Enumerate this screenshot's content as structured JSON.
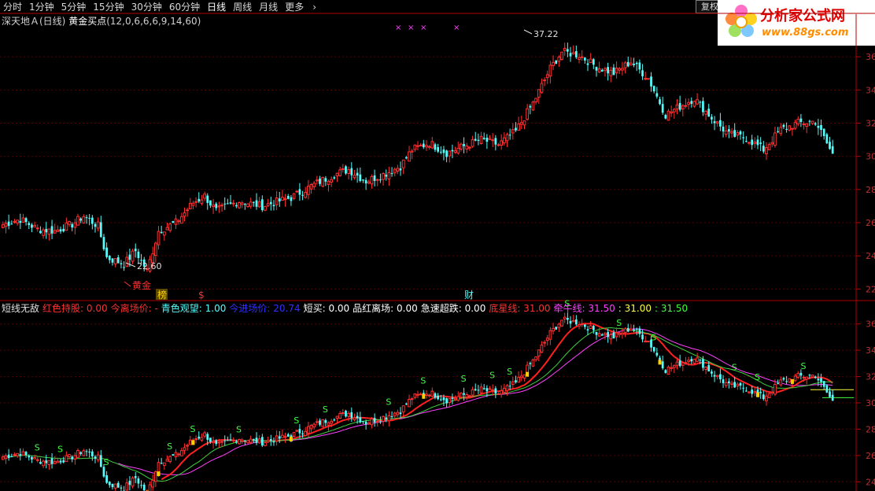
{
  "toolbar": {
    "tabs": [
      "分时",
      "1分钟",
      "5分钟",
      "15分钟",
      "30分钟",
      "60分钟",
      "日线",
      "周线",
      "月线",
      "更多"
    ],
    "active_tab": "日线",
    "more_icon": "chevron-right-icon",
    "right_button": "复权"
  },
  "logo": {
    "title": "分析家公式网",
    "url": "www.88gs.com",
    "icon": "flower-icon"
  },
  "main_panel": {
    "stock_title": "深天地Ａ(日线)",
    "formula_name": "黄金买点",
    "formula_params": "(12,0,6,6,6,9,14,60)",
    "high_label": "37.22",
    "low_label": "22.60",
    "gold_label": "黄金",
    "markers": [
      "榜",
      "$",
      "财"
    ],
    "price_ticks": [
      "36",
      "34",
      "32",
      "30",
      "28",
      "26",
      "24",
      "22"
    ]
  },
  "indicator_panel": {
    "name": "短线无敌",
    "items": [
      {
        "label": "红色持股:",
        "value": "0.00",
        "color": "#ff3030"
      },
      {
        "label": "今离场价:",
        "value": "-",
        "color": "#ff3030"
      },
      {
        "label": "青色观望:",
        "value": "1.00",
        "color": "#54fcfc"
      },
      {
        "label": "今进场价:",
        "value": "20.74",
        "color": "#3030ff"
      },
      {
        "label": "短买:",
        "value": "0.00",
        "color": "#ffffff"
      },
      {
        "label": "品红离场:",
        "value": "0.00",
        "color": "#ffffff"
      },
      {
        "label": "急速超跌:",
        "value": "0.00",
        "color": "#ffffff"
      },
      {
        "label": "底星线:",
        "value": "31.00",
        "color": "#ff3030"
      },
      {
        "label": "牵牛线:",
        "value": "31.50",
        "color": "#ff40ff"
      },
      {
        "label": ":",
        "value": "31.00",
        "color": "#ffff40"
      },
      {
        "label": ":",
        "value": "31.50",
        "color": "#40ff40"
      }
    ],
    "price_ticks": [
      "36",
      "34",
      "32",
      "30",
      "28",
      "26",
      "24"
    ],
    "signal_glyph": "S"
  },
  "colors": {
    "up": "#ff3030",
    "down": "#54fcfc",
    "axis": "#b00000",
    "bg": "#000000"
  }
}
